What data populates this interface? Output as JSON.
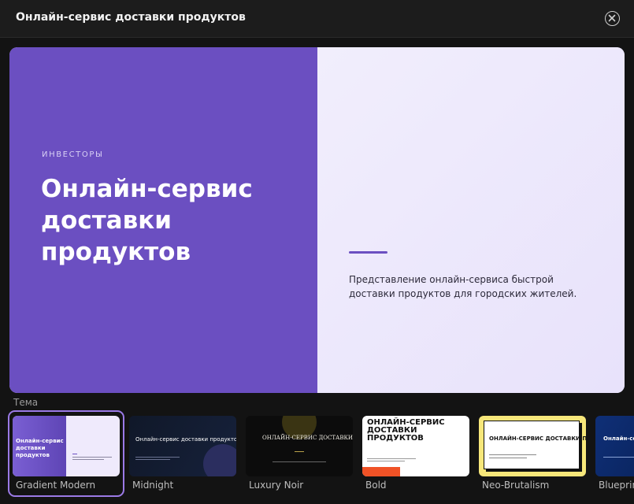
{
  "window": {
    "title": "Онлайн-сервис доставки продуктов",
    "close_icon": "close-circle-icon"
  },
  "preview": {
    "kicker": "ИНВЕСТОРЫ",
    "title": "Онлайн-сервис доставки продуктов",
    "description": "Представление онлайн-сервиса быстрой доставки продуктов для городских жителей.",
    "colors": {
      "left": "#6b4fc1",
      "right": "#ece8fb",
      "accent": "#6b4fc1"
    }
  },
  "themes": {
    "label": "Тема",
    "selected": "Gradient Modern",
    "items": [
      {
        "name": "Gradient Modern",
        "thumb_text": "Онлайн-сервис доставки продуктов"
      },
      {
        "name": "Midnight",
        "thumb_text": "Онлайн-сервис доставки продуктов"
      },
      {
        "name": "Luxury Noir",
        "thumb_text": "ОНЛАЙН-СЕРВИС ДОСТАВКИ"
      },
      {
        "name": "Bold",
        "thumb_text": "ОНЛАЙН-СЕРВИС ДОСТАВКИ ПРОДУКТОВ"
      },
      {
        "name": "Neo-Brutalism",
        "thumb_text": "ОНЛАЙН-СЕРВИС ДОСТАВКИ ПРОДУКТОВ"
      },
      {
        "name": "Blueprint",
        "thumb_text": "Онлайн-сервис доставки продуктов"
      }
    ]
  }
}
